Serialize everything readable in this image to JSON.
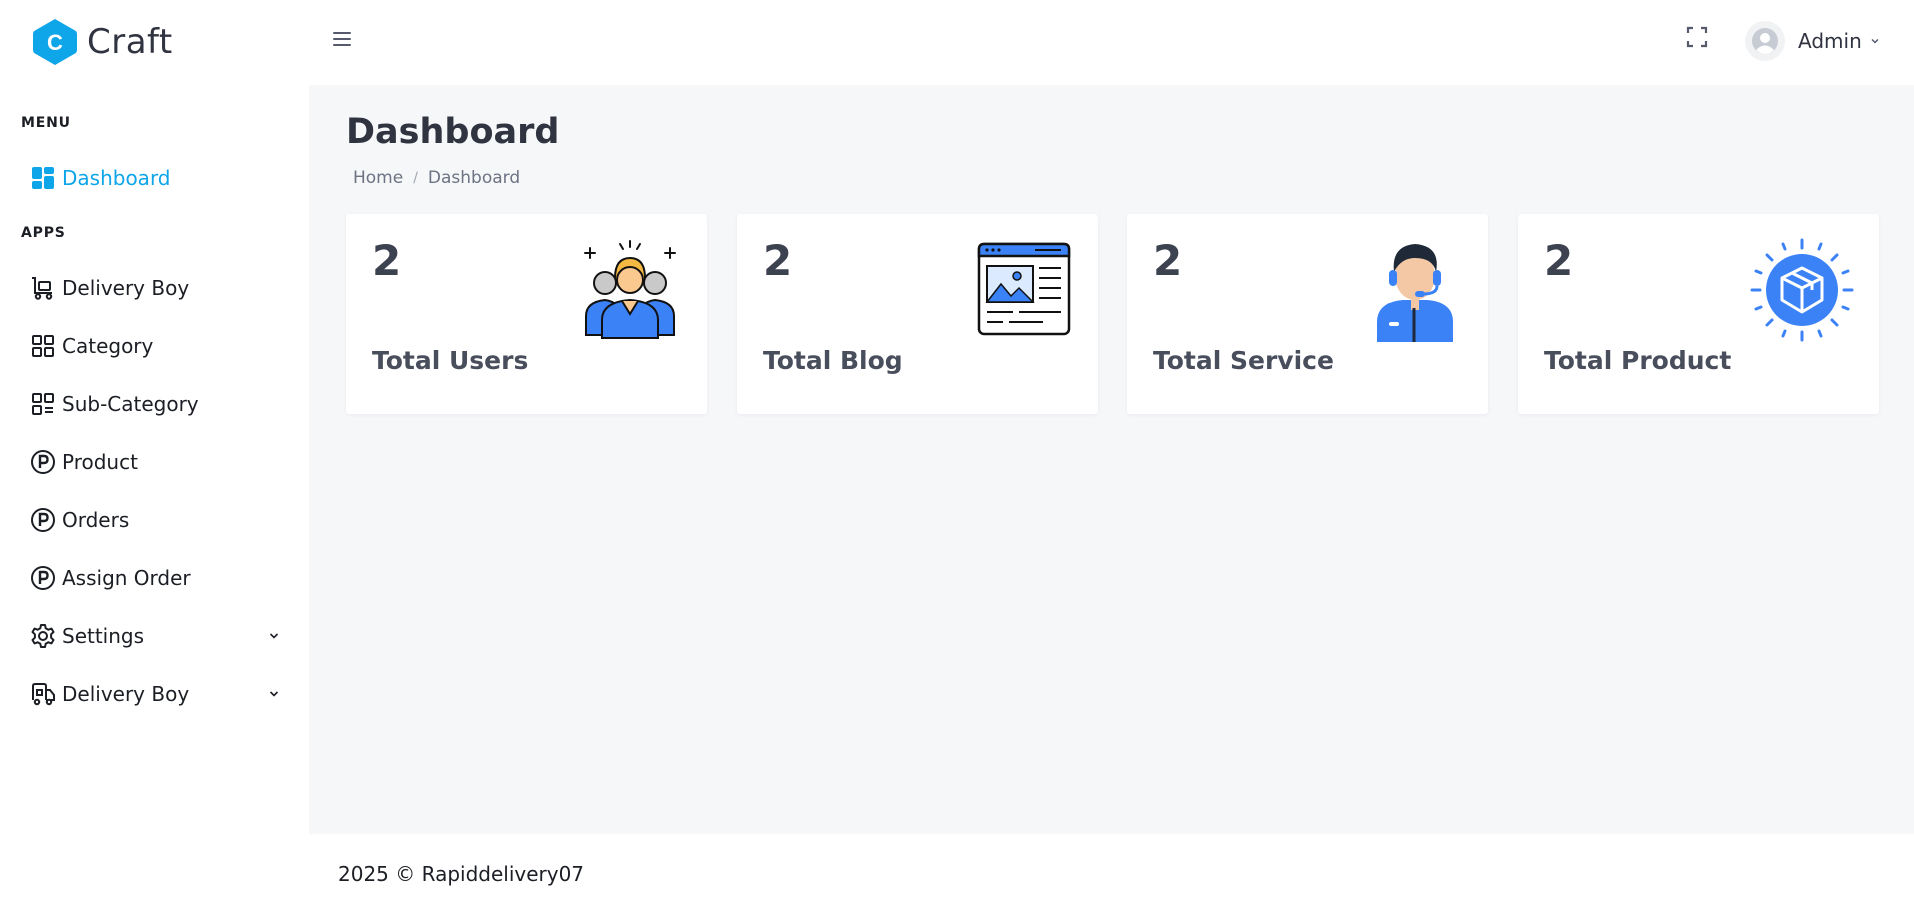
{
  "header": {
    "logo_text": "Craft",
    "logo_letter": "C",
    "user_name": "Admin"
  },
  "sidebar": {
    "menu_title": "MENU",
    "apps_title": "APPS",
    "items": [
      {
        "label": "Dashboard",
        "icon": "dashboard-icon",
        "active": true
      },
      {
        "label": "Delivery Boy",
        "icon": "cart-icon"
      },
      {
        "label": "Category",
        "icon": "grid-icon"
      },
      {
        "label": "Sub-Category",
        "icon": "grid-list-icon"
      },
      {
        "label": "Product",
        "icon": "p-circle-icon"
      },
      {
        "label": "Orders",
        "icon": "p-circle-icon"
      },
      {
        "label": "Assign Order",
        "icon": "p-circle-icon"
      },
      {
        "label": "Settings",
        "icon": "gear-icon",
        "has_submenu": true
      },
      {
        "label": "Delivery Boy",
        "icon": "delivery-truck-icon",
        "has_submenu": true
      }
    ]
  },
  "main": {
    "title": "Dashboard",
    "breadcrumb": [
      "Home",
      "Dashboard"
    ],
    "cards": [
      {
        "value": "2",
        "label": "Total Users",
        "icon": "users-group-icon"
      },
      {
        "value": "2",
        "label": "Total Blog",
        "icon": "blog-page-icon"
      },
      {
        "value": "2",
        "label": "Total Service",
        "icon": "support-agent-icon"
      },
      {
        "value": "2",
        "label": "Total Product",
        "icon": "product-box-icon"
      }
    ]
  },
  "footer": {
    "text": "2025 © Rapiddelivery07"
  },
  "colors": {
    "accent": "#0ea5e9",
    "icon_blue": "#3b82f6",
    "background": "#f6f7f9"
  }
}
